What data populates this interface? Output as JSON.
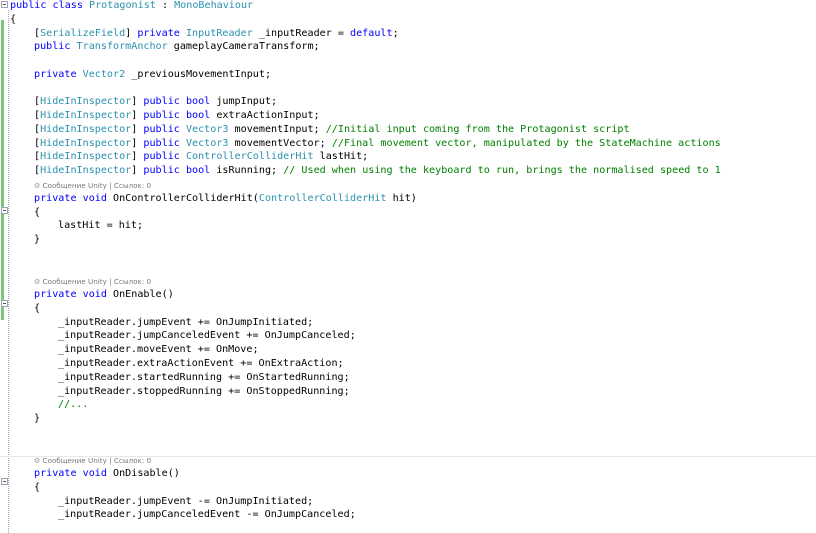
{
  "editor": {
    "language": "C#",
    "colors": {
      "keyword": "#0000ff",
      "type": "#2b91af",
      "comment": "#008000",
      "text": "#000000",
      "codelens": "#7a7a7a",
      "change_bar": "#7bc67b"
    },
    "code_lines": [
      {
        "indent": 0,
        "segments": [
          {
            "k": "kw",
            "t": "public"
          },
          {
            "k": "pl",
            "t": " "
          },
          {
            "k": "kw",
            "t": "class"
          },
          {
            "k": "pl",
            "t": " "
          },
          {
            "k": "ty",
            "t": "Protagonist"
          },
          {
            "k": "pl",
            "t": " : "
          },
          {
            "k": "ty",
            "t": "MonoBehaviour"
          }
        ]
      },
      {
        "indent": 0,
        "segments": [
          {
            "k": "pl",
            "t": "{"
          }
        ]
      },
      {
        "indent": 1,
        "segments": [
          {
            "k": "pl",
            "t": "["
          },
          {
            "k": "ty",
            "t": "SerializeField"
          },
          {
            "k": "pl",
            "t": "] "
          },
          {
            "k": "kw",
            "t": "private"
          },
          {
            "k": "pl",
            "t": " "
          },
          {
            "k": "ty",
            "t": "InputReader"
          },
          {
            "k": "pl",
            "t": " _inputReader = "
          },
          {
            "k": "kw",
            "t": "default"
          },
          {
            "k": "pl",
            "t": ";"
          }
        ]
      },
      {
        "indent": 1,
        "segments": [
          {
            "k": "kw",
            "t": "public"
          },
          {
            "k": "pl",
            "t": " "
          },
          {
            "k": "ty",
            "t": "TransformAnchor"
          },
          {
            "k": "pl",
            "t": " gameplayCameraTransform;"
          }
        ]
      },
      {
        "indent": 0,
        "segments": []
      },
      {
        "indent": 1,
        "segments": [
          {
            "k": "kw",
            "t": "private"
          },
          {
            "k": "pl",
            "t": " "
          },
          {
            "k": "ty",
            "t": "Vector2"
          },
          {
            "k": "pl",
            "t": " _previousMovementInput;"
          }
        ]
      },
      {
        "indent": 0,
        "segments": []
      },
      {
        "indent": 1,
        "segments": [
          {
            "k": "pl",
            "t": "["
          },
          {
            "k": "ty",
            "t": "HideInInspector"
          },
          {
            "k": "pl",
            "t": "] "
          },
          {
            "k": "kw",
            "t": "public"
          },
          {
            "k": "pl",
            "t": " "
          },
          {
            "k": "kw",
            "t": "bool"
          },
          {
            "k": "pl",
            "t": " jumpInput;"
          }
        ]
      },
      {
        "indent": 1,
        "segments": [
          {
            "k": "pl",
            "t": "["
          },
          {
            "k": "ty",
            "t": "HideInInspector"
          },
          {
            "k": "pl",
            "t": "] "
          },
          {
            "k": "kw",
            "t": "public"
          },
          {
            "k": "pl",
            "t": " "
          },
          {
            "k": "kw",
            "t": "bool"
          },
          {
            "k": "pl",
            "t": " extraActionInput;"
          }
        ]
      },
      {
        "indent": 1,
        "segments": [
          {
            "k": "pl",
            "t": "["
          },
          {
            "k": "ty",
            "t": "HideInInspector"
          },
          {
            "k": "pl",
            "t": "] "
          },
          {
            "k": "kw",
            "t": "public"
          },
          {
            "k": "pl",
            "t": " "
          },
          {
            "k": "ty",
            "t": "Vector3"
          },
          {
            "k": "pl",
            "t": " movementInput; "
          },
          {
            "k": "cm",
            "t": "//Initial input coming from the Protagonist script"
          }
        ]
      },
      {
        "indent": 1,
        "segments": [
          {
            "k": "pl",
            "t": "["
          },
          {
            "k": "ty",
            "t": "HideInInspector"
          },
          {
            "k": "pl",
            "t": "] "
          },
          {
            "k": "kw",
            "t": "public"
          },
          {
            "k": "pl",
            "t": " "
          },
          {
            "k": "ty",
            "t": "Vector3"
          },
          {
            "k": "pl",
            "t": " movementVector; "
          },
          {
            "k": "cm",
            "t": "//Final movement vector, manipulated by the StateMachine actions"
          }
        ]
      },
      {
        "indent": 1,
        "segments": [
          {
            "k": "pl",
            "t": "["
          },
          {
            "k": "ty",
            "t": "HideInInspector"
          },
          {
            "k": "pl",
            "t": "] "
          },
          {
            "k": "kw",
            "t": "public"
          },
          {
            "k": "pl",
            "t": " "
          },
          {
            "k": "ty",
            "t": "ControllerColliderHit"
          },
          {
            "k": "pl",
            "t": " lastHit;"
          }
        ]
      },
      {
        "indent": 1,
        "segments": [
          {
            "k": "pl",
            "t": "["
          },
          {
            "k": "ty",
            "t": "HideInInspector"
          },
          {
            "k": "pl",
            "t": "] "
          },
          {
            "k": "kw",
            "t": "public"
          },
          {
            "k": "pl",
            "t": " "
          },
          {
            "k": "kw",
            "t": "bool"
          },
          {
            "k": "pl",
            "t": " isRunning; "
          },
          {
            "k": "cm",
            "t": "// Used when using the keyboard to run, brings the normalised speed to 1"
          }
        ]
      },
      {
        "lens": "Сообщение Unity | Ссылок: 0"
      },
      {
        "indent": 1,
        "segments": [
          {
            "k": "kw",
            "t": "private"
          },
          {
            "k": "pl",
            "t": " "
          },
          {
            "k": "kw",
            "t": "void"
          },
          {
            "k": "pl",
            "t": " OnControllerColliderHit("
          },
          {
            "k": "ty",
            "t": "ControllerColliderHit"
          },
          {
            "k": "pl",
            "t": " hit)"
          }
        ]
      },
      {
        "indent": 1,
        "segments": [
          {
            "k": "pl",
            "t": "{"
          }
        ]
      },
      {
        "indent": 2,
        "segments": [
          {
            "k": "pl",
            "t": "lastHit = hit;"
          }
        ]
      },
      {
        "indent": 1,
        "segments": [
          {
            "k": "pl",
            "t": "}"
          }
        ]
      },
      {
        "indent": 0,
        "segments": []
      },
      {
        "indent": 0,
        "segments": []
      },
      {
        "lens": "Сообщение Unity | Ссылок: 0"
      },
      {
        "indent": 1,
        "segments": [
          {
            "k": "kw",
            "t": "private"
          },
          {
            "k": "pl",
            "t": " "
          },
          {
            "k": "kw",
            "t": "void"
          },
          {
            "k": "pl",
            "t": " OnEnable()"
          }
        ]
      },
      {
        "indent": 1,
        "segments": [
          {
            "k": "pl",
            "t": "{"
          }
        ]
      },
      {
        "indent": 2,
        "segments": [
          {
            "k": "pl",
            "t": "_inputReader.jumpEvent += OnJumpInitiated;"
          }
        ]
      },
      {
        "indent": 2,
        "segments": [
          {
            "k": "pl",
            "t": "_inputReader.jumpCanceledEvent += OnJumpCanceled;"
          }
        ]
      },
      {
        "indent": 2,
        "segments": [
          {
            "k": "pl",
            "t": "_inputReader.moveEvent += OnMove;"
          }
        ]
      },
      {
        "indent": 2,
        "segments": [
          {
            "k": "pl",
            "t": "_inputReader.extraActionEvent += OnExtraAction;"
          }
        ]
      },
      {
        "indent": 2,
        "segments": [
          {
            "k": "pl",
            "t": "_inputReader.startedRunning += OnStartedRunning;"
          }
        ]
      },
      {
        "indent": 2,
        "segments": [
          {
            "k": "pl",
            "t": "_inputReader.stoppedRunning += OnStoppedRunning;"
          }
        ]
      },
      {
        "indent": 2,
        "segments": [
          {
            "k": "cm",
            "t": "//..."
          }
        ]
      },
      {
        "indent": 1,
        "segments": [
          {
            "k": "pl",
            "t": "}"
          }
        ]
      },
      {
        "indent": 0,
        "segments": []
      },
      {
        "indent": 0,
        "segments": []
      },
      {
        "lens": "Сообщение Unity | Ссылок: 0"
      },
      {
        "indent": 1,
        "segments": [
          {
            "k": "kw",
            "t": "private"
          },
          {
            "k": "pl",
            "t": " "
          },
          {
            "k": "kw",
            "t": "void"
          },
          {
            "k": "pl",
            "t": " OnDisable()"
          }
        ]
      },
      {
        "indent": 1,
        "segments": [
          {
            "k": "pl",
            "t": "{"
          }
        ]
      },
      {
        "indent": 2,
        "segments": [
          {
            "k": "pl",
            "t": "_inputReader.jumpEvent -= OnJumpInitiated;"
          }
        ]
      },
      {
        "indent": 2,
        "segments": [
          {
            "k": "pl",
            "t": "_inputReader.jumpCanceledEvent -= OnJumpCanceled;"
          }
        ]
      }
    ]
  }
}
